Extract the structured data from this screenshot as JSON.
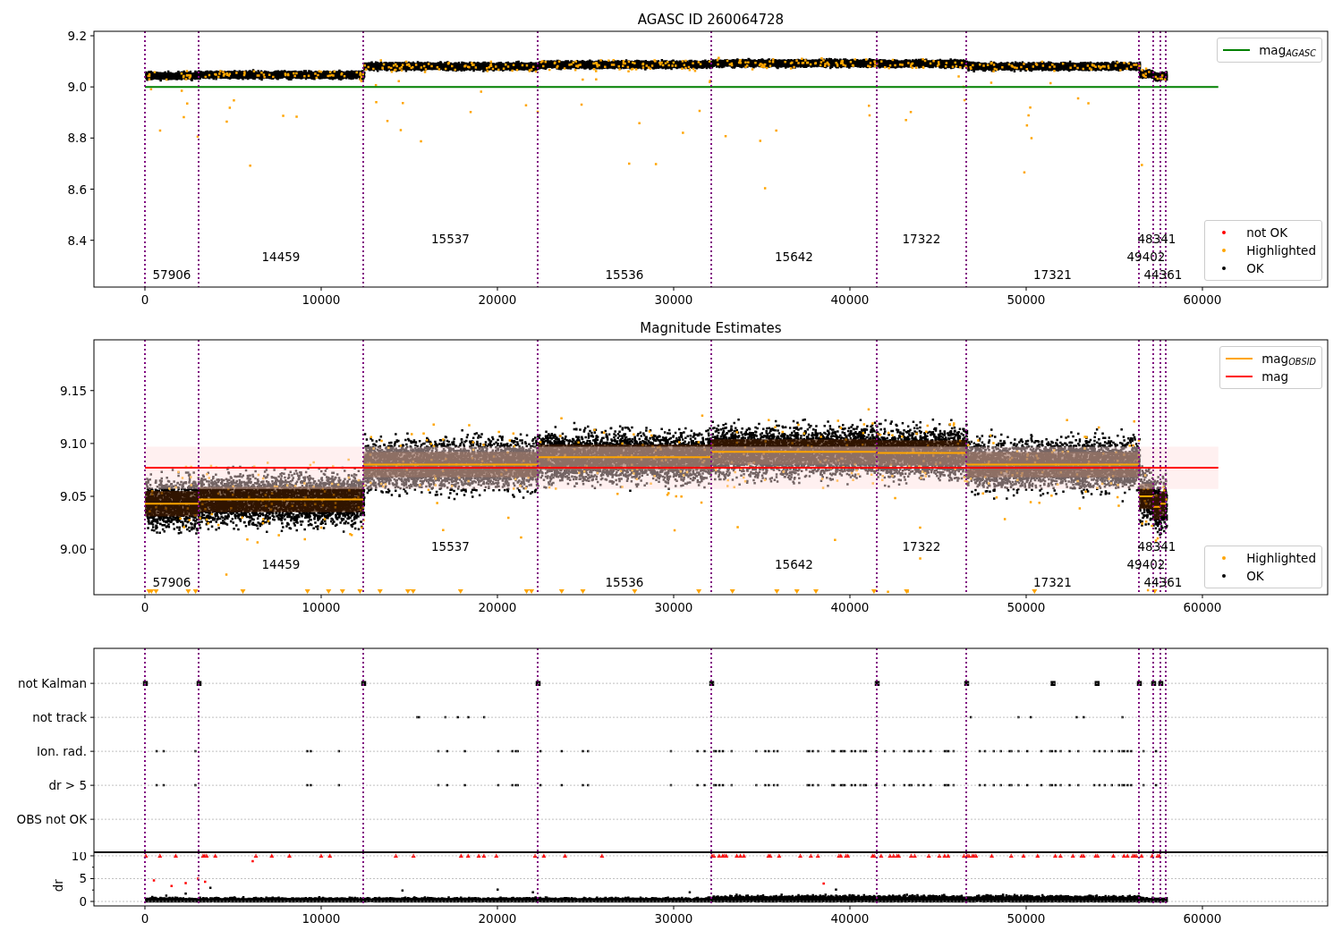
{
  "panels": [
    {
      "kind": "agasc",
      "chart_data": {
        "type": "line",
        "title": "AGASC ID 260064728",
        "xlim": [
          -2893,
          67107
        ],
        "ylim": [
          8.217,
          9.2175
        ],
        "xticks": [
          0,
          10000,
          20000,
          30000,
          40000,
          50000,
          60000
        ],
        "yticks": [
          {
            "value": 8.4,
            "label": "8.4"
          },
          {
            "value": 8.6,
            "label": "8.6"
          },
          {
            "value": 8.8,
            "label": "8.8"
          },
          {
            "value": 9.0,
            "label": "9.0"
          },
          {
            "value": 9.2,
            "label": "9.2"
          }
        ],
        "series": [
          {
            "name": "mag$_{AGASC}$",
            "color": "#008000",
            "x": [
              0,
              60900
            ],
            "values": [
              9.0,
              9.0
            ]
          }
        ],
        "ref_lines": [
          {
            "axis": "x",
            "value": 0
          },
          {
            "axis": "x",
            "value": 3046
          },
          {
            "axis": "x",
            "value": 12386
          },
          {
            "axis": "x",
            "value": 22284
          },
          {
            "axis": "x",
            "value": 32132
          },
          {
            "axis": "x",
            "value": 41523
          },
          {
            "axis": "x",
            "value": 46599
          },
          {
            "axis": "x",
            "value": 56396
          },
          {
            "axis": "x",
            "value": 57208
          },
          {
            "axis": "x",
            "value": 57614
          },
          {
            "axis": "x",
            "value": 57919
          }
        ],
        "annotations": [
          "57906",
          "14459",
          "15537",
          "15536",
          "15642",
          "17322",
          "17321",
          "49402",
          "48341",
          "44361"
        ]
      },
      "point_legend": [
        {
          "label": "not OK",
          "color": "#ff0000"
        },
        {
          "label": "Highlighted",
          "color": "#ffa500"
        },
        {
          "label": "OK",
          "color": "#000000"
        }
      ]
    },
    {
      "kind": "estimates",
      "chart_data": {
        "type": "line",
        "title": "Magnitude Estimates",
        "xlim": [
          -2893,
          67107
        ],
        "ylim": [
          8.957,
          9.198
        ],
        "xticks": [
          0,
          10000,
          20000,
          30000,
          40000,
          50000,
          60000
        ],
        "yticks": [
          {
            "value": 9.0,
            "label": "9.00"
          },
          {
            "value": 9.05,
            "label": "9.05"
          },
          {
            "value": 9.1,
            "label": "9.10"
          },
          {
            "value": 9.15,
            "label": "9.15"
          }
        ],
        "series": [
          {
            "name": "mag$_{OBSID}$",
            "color": "#ffa500",
            "x": [
              0,
              3046,
              3046,
              12386,
              12386,
              22284,
              22284,
              32132,
              32132,
              41523,
              41523,
              46599,
              46599,
              56396,
              56396,
              57208,
              57208,
              57614,
              57614,
              57919
            ],
            "values": [
              9.043,
              9.043,
              9.047,
              9.047,
              9.08,
              9.08,
              9.087,
              9.087,
              9.092,
              9.092,
              9.091,
              9.091,
              9.08,
              9.08,
              9.05,
              9.05,
              9.04,
              9.04,
              9.043,
              9.043
            ]
          },
          {
            "name": "mag",
            "color": "#ff0000",
            "x": [
              0,
              60900
            ],
            "values": [
              9.077,
              9.077
            ]
          }
        ],
        "bands": [
          {
            "axis": "y",
            "from": 9.057,
            "to": 9.097,
            "color": "#ffdddd"
          }
        ],
        "ref_lines": [
          {
            "axis": "x",
            "value": 0
          },
          {
            "axis": "x",
            "value": 3046
          },
          {
            "axis": "x",
            "value": 12386
          },
          {
            "axis": "x",
            "value": 22284
          },
          {
            "axis": "x",
            "value": 32132
          },
          {
            "axis": "x",
            "value": 41523
          },
          {
            "axis": "x",
            "value": 46599
          },
          {
            "axis": "x",
            "value": 56396
          },
          {
            "axis": "x",
            "value": 57208
          },
          {
            "axis": "x",
            "value": 57614
          },
          {
            "axis": "x",
            "value": 57919
          }
        ],
        "annotations": [
          "57906",
          "14459",
          "15537",
          "15536",
          "15642",
          "17322",
          "17321",
          "49402",
          "48341",
          "44361"
        ]
      },
      "point_legend": [
        {
          "label": "Highlighted",
          "color": "#ffa500"
        },
        {
          "label": "OK",
          "color": "#000000"
        }
      ]
    },
    {
      "kind": "flags",
      "chart_data": {
        "type": "scatter",
        "orientation": "horizontal",
        "grid": true,
        "xlim": [
          -2893,
          67107
        ],
        "categories": [
          "not Kalman",
          "not track",
          "Ion. rad.",
          "dr > 5",
          "OBS not OK"
        ],
        "ref_lines": [
          {
            "axis": "x",
            "value": 0
          },
          {
            "axis": "x",
            "value": 3046
          },
          {
            "axis": "x",
            "value": 12386
          },
          {
            "axis": "x",
            "value": 22284
          },
          {
            "axis": "x",
            "value": 32132
          },
          {
            "axis": "x",
            "value": 41523
          },
          {
            "axis": "x",
            "value": 46599
          },
          {
            "axis": "x",
            "value": 56396
          },
          {
            "axis": "x",
            "value": 57208
          },
          {
            "axis": "x",
            "value": 57614
          },
          {
            "axis": "x",
            "value": 57919
          }
        ]
      }
    },
    {
      "kind": "dr",
      "chart_data": {
        "type": "scatter",
        "ylabel": "dr",
        "grid": true,
        "xlim": [
          -2893,
          67107
        ],
        "ylim": [
          -0.98,
          10.78
        ],
        "xticks": [
          0,
          10000,
          20000,
          30000,
          40000,
          50000,
          60000
        ],
        "yticks": [
          0,
          5,
          10
        ],
        "ref_lines": [
          {
            "axis": "x",
            "value": 0
          },
          {
            "axis": "x",
            "value": 3046
          },
          {
            "axis": "x",
            "value": 12386
          },
          {
            "axis": "x",
            "value": 22284
          },
          {
            "axis": "x",
            "value": 32132
          },
          {
            "axis": "x",
            "value": 41523
          },
          {
            "axis": "x",
            "value": 46599
          },
          {
            "axis": "x",
            "value": 56396
          },
          {
            "axis": "x",
            "value": 57208
          },
          {
            "axis": "x",
            "value": 57614
          },
          {
            "axis": "x",
            "value": 57919
          }
        ]
      }
    }
  ]
}
